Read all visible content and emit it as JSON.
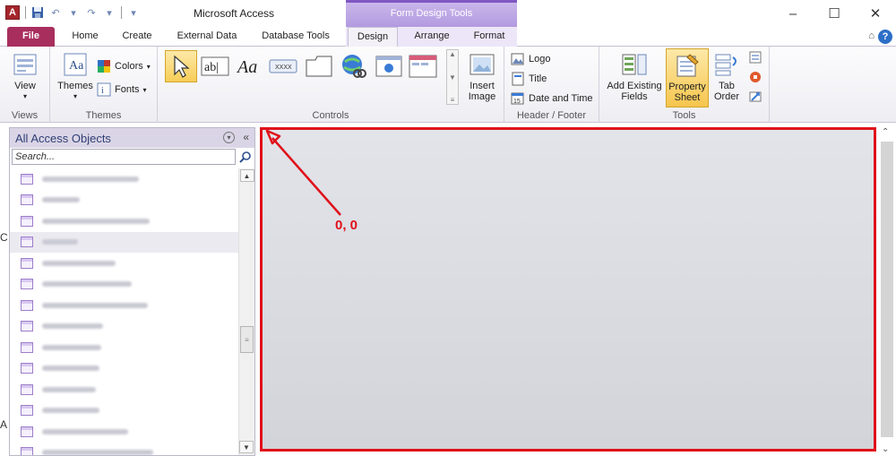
{
  "window": {
    "title": "Microsoft Access",
    "contextual_title": "Form Design Tools"
  },
  "tabs": [
    "File",
    "Home",
    "Create",
    "External Data",
    "Database Tools",
    "Design",
    "Arrange",
    "Format"
  ],
  "ribbon": {
    "views": {
      "view_label": "View",
      "group_label": "Views"
    },
    "themes": {
      "themes_label": "Themes",
      "colors_label": "Colors",
      "fonts_label": "Fonts",
      "group_label": "Themes"
    },
    "controls": {
      "group_label": "Controls",
      "textbox_label": "ab|",
      "label_label": "Aa",
      "button_label": "xxxx",
      "insert_image_label": "Insert\nImage"
    },
    "header_footer": {
      "logo_label": "Logo",
      "title_label": "Title",
      "date_time_label": "Date and Time",
      "group_label": "Header / Footer"
    },
    "tools": {
      "add_fields_label": "Add Existing\nFields",
      "property_sheet_label": "Property\nSheet",
      "tab_order_label": "Tab\nOrder",
      "group_label": "Tools"
    }
  },
  "nav_pane": {
    "header": "All Access Objects",
    "search_placeholder": "Search..."
  },
  "annotation": {
    "origin_label": "0, 0"
  },
  "colors": {
    "accent": "#e0101a",
    "file_tab": "#a82e5e",
    "contextual": "#7e57c2"
  }
}
